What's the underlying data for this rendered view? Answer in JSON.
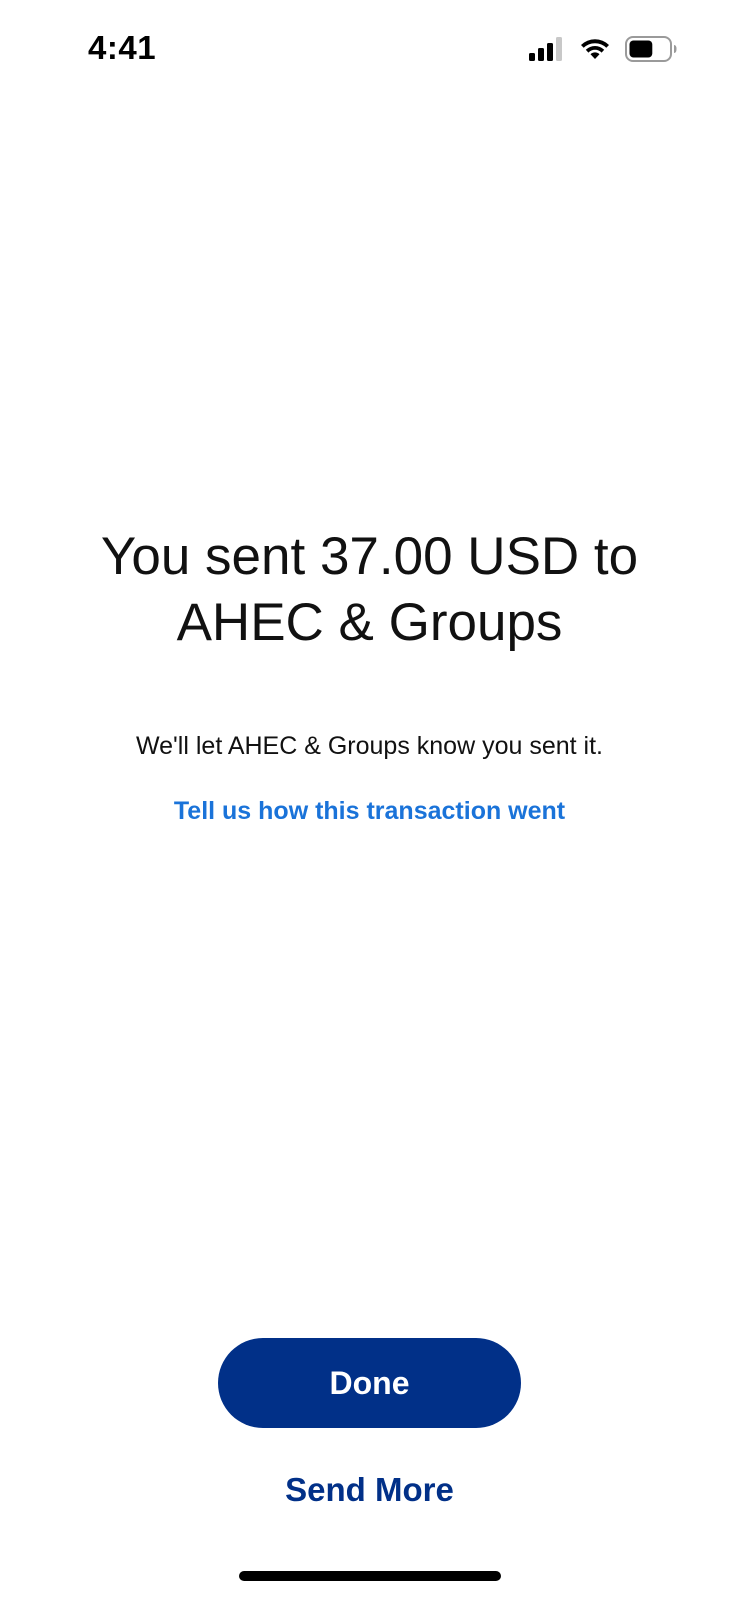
{
  "status_bar": {
    "time": "4:41",
    "icons": [
      "signal-icon",
      "wifi-icon",
      "battery-icon"
    ],
    "battery_level": 0.6
  },
  "confirmation": {
    "headline": "You sent 37.00 USD to AHEC & Groups",
    "subtext": "We'll let AHEC & Groups know you sent it.",
    "feedback_link": "Tell us how this transaction went"
  },
  "actions": {
    "done_label": "Done",
    "send_more_label": "Send More"
  },
  "colors": {
    "primary": "#013088",
    "link": "#1a73d9",
    "text": "#111111",
    "background": "#ffffff"
  }
}
